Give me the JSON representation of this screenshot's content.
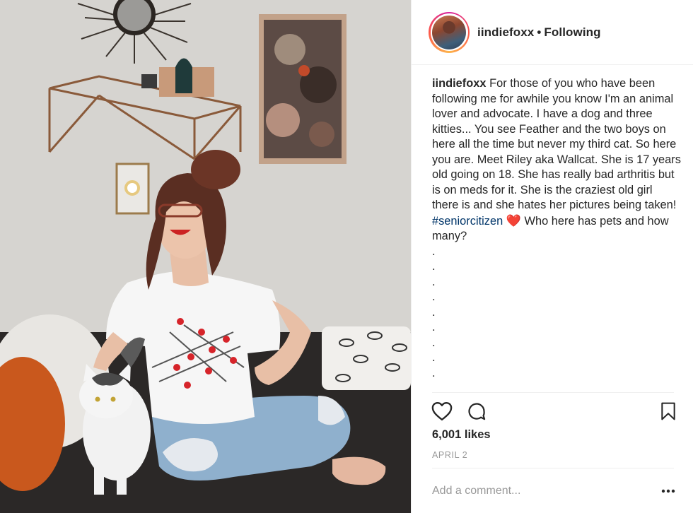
{
  "post": {
    "username": "iindiefoxx",
    "separator": "•",
    "follow_status": "Following",
    "caption_user": "iindiefoxx",
    "caption_text_1": " For those of you who have been following me for awhile you know I'm an animal lover and advocate. I have a dog and three kitties... You see Feather and the two boys on here all the time but never my third cat. So here you are. Meet Riley aka Wallcat. She is 17 years old going on 18. She has really bad arthritis but is on meds for it. She is the craziest old girl there is and she hates her pictures being taken! ",
    "hashtag": "#seniorcitizen",
    "heart_emoji": "❤️",
    "caption_text_2": " Who here has pets and how many?",
    "dot_lines": [
      ".",
      ".",
      ".",
      ".",
      ".",
      ".",
      ".",
      ".",
      "."
    ],
    "likes": "6,001 likes",
    "date": "April 2",
    "comment_placeholder": "Add a comment...",
    "more_label": "•••"
  },
  "icons": {
    "like": "heart-outline-icon",
    "comment": "speech-bubble-icon",
    "save": "bookmark-icon",
    "more": "ellipsis-icon"
  },
  "colors": {
    "text": "#262626",
    "hashtag": "#003569",
    "muted": "#999999",
    "divider": "#efefef",
    "story_ring": "#d6249f"
  }
}
